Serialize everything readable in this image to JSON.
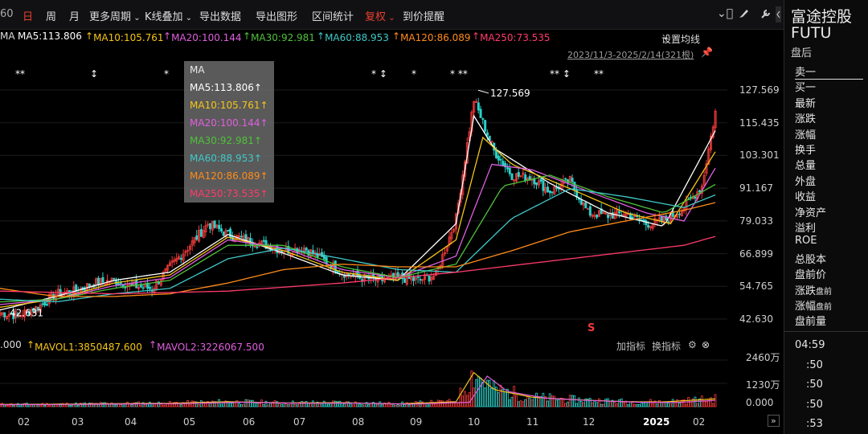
{
  "toolbar": {
    "partial_period": "60",
    "items": [
      {
        "label": "日",
        "active": true
      },
      {
        "label": "周"
      },
      {
        "label": "月"
      },
      {
        "label": "更多周期",
        "dropdown": true
      },
      {
        "label": "K线叠加",
        "dropdown": true
      },
      {
        "label": "导出数据"
      },
      {
        "label": "导出图形"
      },
      {
        "label": "区间统计"
      },
      {
        "label": "复权",
        "dropdown": true,
        "red": true
      },
      {
        "label": "到价提醒"
      }
    ],
    "icons": [
      "chevron-circle-icon",
      "brush-icon",
      "wrench-icon",
      "panel-toggle-icon"
    ]
  },
  "ma_row": {
    "prefix": "MA",
    "items": [
      {
        "text": "MA5:113.806",
        "color": "#ffffff"
      },
      {
        "text": "MA10:105.761",
        "color": "#f5c518"
      },
      {
        "text": "MA20:100.144",
        "color": "#e05fe0"
      },
      {
        "text": "MA30:92.981",
        "color": "#4fc23a"
      },
      {
        "text": "MA60:88.953",
        "color": "#3fc9c9"
      },
      {
        "text": "MA120:86.089",
        "color": "#ff8c1a"
      },
      {
        "text": "MA250:73.535",
        "color": "#ff3b6b"
      }
    ],
    "settings": "设置均线"
  },
  "period_info": "2023/11/3-2025/2/14(321根)",
  "popup": {
    "title": "MA",
    "items": [
      "MA5:113.806",
      "MA10:105.761",
      "MA20:100.144",
      "MA30:92.981",
      "MA60:88.953",
      "MA120:86.089",
      "MA250:73.535"
    ]
  },
  "vol_row": {
    "prefix": ".000",
    "mavol1": "MAVOL1:3850487.600",
    "mavol2": "MAVOL2:3226067.500",
    "add_indicator": "加指标",
    "switch_indicator": "换指标"
  },
  "chart_data": {
    "type": "candlestick",
    "y_ticks": [
      "127.569",
      "115.435",
      "103.301",
      "91.167",
      "79.033",
      "66.899",
      "54.765",
      "42.630"
    ],
    "y_range": [
      42.63,
      127.569
    ],
    "max_label": "127.569",
    "min_label": "42.631",
    "x_ticks": [
      "02",
      "03",
      "04",
      "05",
      "06",
      "07",
      "08",
      "09",
      "10",
      "11",
      "12",
      "2025",
      "02"
    ],
    "vol_ticks": [
      "2460万",
      "1230万",
      "0.000"
    ],
    "close_keypoints": [
      [
        0,
        45
      ],
      [
        8,
        44
      ],
      [
        17,
        47
      ],
      [
        25,
        52
      ],
      [
        34,
        53
      ],
      [
        42,
        56
      ],
      [
        51,
        57
      ],
      [
        59,
        55
      ],
      [
        68,
        54
      ],
      [
        76,
        62
      ],
      [
        85,
        70
      ],
      [
        93,
        78
      ],
      [
        102,
        74
      ],
      [
        110,
        72
      ],
      [
        119,
        70
      ],
      [
        127,
        68
      ],
      [
        136,
        69
      ],
      [
        144,
        65
      ],
      [
        153,
        60
      ],
      [
        161,
        58
      ],
      [
        170,
        57
      ],
      [
        178,
        58
      ],
      [
        187,
        57
      ],
      [
        195,
        59
      ],
      [
        204,
        80
      ],
      [
        212,
        124
      ],
      [
        221,
        105
      ],
      [
        229,
        96
      ],
      [
        238,
        95
      ],
      [
        246,
        90
      ],
      [
        255,
        94
      ],
      [
        263,
        82
      ],
      [
        272,
        81
      ],
      [
        280,
        82
      ],
      [
        289,
        78
      ],
      [
        297,
        79
      ],
      [
        306,
        84
      ],
      [
        314,
        92
      ],
      [
        321,
        124
      ]
    ],
    "ma_keypoints": {
      "MA5": [
        [
          0,
          46
        ],
        [
          25,
          51
        ],
        [
          51,
          57
        ],
        [
          76,
          60
        ],
        [
          102,
          74
        ],
        [
          127,
          67
        ],
        [
          153,
          59
        ],
        [
          178,
          57
        ],
        [
          204,
          78
        ],
        [
          212,
          118
        ],
        [
          221,
          106
        ],
        [
          246,
          93
        ],
        [
          272,
          82
        ],
        [
          297,
          77
        ],
        [
          321,
          114
        ]
      ],
      "MA10": [
        [
          0,
          47
        ],
        [
          25,
          50
        ],
        [
          51,
          56
        ],
        [
          76,
          59
        ],
        [
          102,
          73
        ],
        [
          127,
          68
        ],
        [
          153,
          60
        ],
        [
          178,
          57
        ],
        [
          204,
          72
        ],
        [
          216,
          110
        ],
        [
          229,
          100
        ],
        [
          255,
          91
        ],
        [
          280,
          82
        ],
        [
          300,
          78
        ],
        [
          321,
          106
        ]
      ],
      "MA20": [
        [
          0,
          48
        ],
        [
          25,
          50
        ],
        [
          51,
          55
        ],
        [
          76,
          58
        ],
        [
          102,
          72
        ],
        [
          127,
          69
        ],
        [
          153,
          61
        ],
        [
          178,
          58
        ],
        [
          204,
          66
        ],
        [
          220,
          100
        ],
        [
          238,
          98
        ],
        [
          263,
          90
        ],
        [
          289,
          82
        ],
        [
          306,
          79
        ],
        [
          321,
          100
        ]
      ],
      "MA30": [
        [
          0,
          49
        ],
        [
          25,
          50
        ],
        [
          51,
          54
        ],
        [
          76,
          57
        ],
        [
          102,
          70
        ],
        [
          127,
          70
        ],
        [
          153,
          62
        ],
        [
          178,
          58
        ],
        [
          204,
          63
        ],
        [
          225,
          92
        ],
        [
          246,
          96
        ],
        [
          272,
          88
        ],
        [
          297,
          82
        ],
        [
          321,
          93
        ]
      ],
      "MA60": [
        [
          0,
          50
        ],
        [
          25,
          49
        ],
        [
          51,
          52
        ],
        [
          76,
          54
        ],
        [
          102,
          65
        ],
        [
          127,
          69
        ],
        [
          153,
          65
        ],
        [
          178,
          61
        ],
        [
          204,
          60
        ],
        [
          229,
          80
        ],
        [
          255,
          91
        ],
        [
          280,
          88
        ],
        [
          306,
          84
        ],
        [
          321,
          89
        ]
      ],
      "MA120": [
        [
          0,
          54
        ],
        [
          25,
          51
        ],
        [
          51,
          51
        ],
        [
          76,
          52
        ],
        [
          102,
          56
        ],
        [
          127,
          61
        ],
        [
          153,
          63
        ],
        [
          178,
          62
        ],
        [
          204,
          62
        ],
        [
          229,
          68
        ],
        [
          255,
          75
        ],
        [
          280,
          79
        ],
        [
          306,
          83
        ],
        [
          321,
          86
        ]
      ],
      "MA250": [
        [
          0,
          53
        ],
        [
          51,
          52
        ],
        [
          102,
          53
        ],
        [
          153,
          56
        ],
        [
          204,
          60
        ],
        [
          255,
          65
        ],
        [
          306,
          70
        ],
        [
          321,
          73.5
        ]
      ]
    },
    "volume_keypoints": [
      [
        0,
        120
      ],
      [
        25,
        130
      ],
      [
        51,
        160
      ],
      [
        76,
        180
      ],
      [
        102,
        260
      ],
      [
        127,
        200
      ],
      [
        153,
        210
      ],
      [
        178,
        150
      ],
      [
        204,
        260
      ],
      [
        212,
        1800
      ],
      [
        221,
        900
      ],
      [
        238,
        500
      ],
      [
        255,
        380
      ],
      [
        280,
        260
      ],
      [
        297,
        250
      ],
      [
        321,
        420
      ]
    ],
    "markers": [
      {
        "x": 25,
        "label": "**"
      },
      {
        "x": 118,
        "label": "↕"
      },
      {
        "x": 210,
        "label": "*"
      },
      {
        "x": 468,
        "label": "* ↕"
      },
      {
        "x": 518,
        "label": "*"
      },
      {
        "x": 566,
        "label": "* **"
      },
      {
        "x": 690,
        "label": "** ↕"
      },
      {
        "x": 745,
        "label": "**"
      }
    ],
    "s_marker": "S"
  },
  "right_panel": {
    "name": "富途控股",
    "code": "FUTU",
    "session": "盘后",
    "items": [
      {
        "label": "卖一",
        "underline": true
      },
      {
        "label": "买一"
      },
      {
        "label": "最新"
      },
      {
        "label": "涨跌"
      },
      {
        "label": "涨幅"
      },
      {
        "label": "换手"
      },
      {
        "label": "总量"
      },
      {
        "label": "外盘"
      },
      {
        "label": "收益"
      },
      {
        "label": "净资产"
      },
      {
        "label": "溢利"
      },
      {
        "label": "ROE"
      },
      {
        "label": "总股本"
      },
      {
        "label": "盘前价"
      },
      {
        "label": "涨跌",
        "small": "盘前"
      },
      {
        "label": "涨幅",
        "small": "盘前"
      },
      {
        "label": "盘前量"
      }
    ],
    "times": [
      "04:59",
      ":50",
      ":50",
      ":50",
      ":53"
    ]
  }
}
